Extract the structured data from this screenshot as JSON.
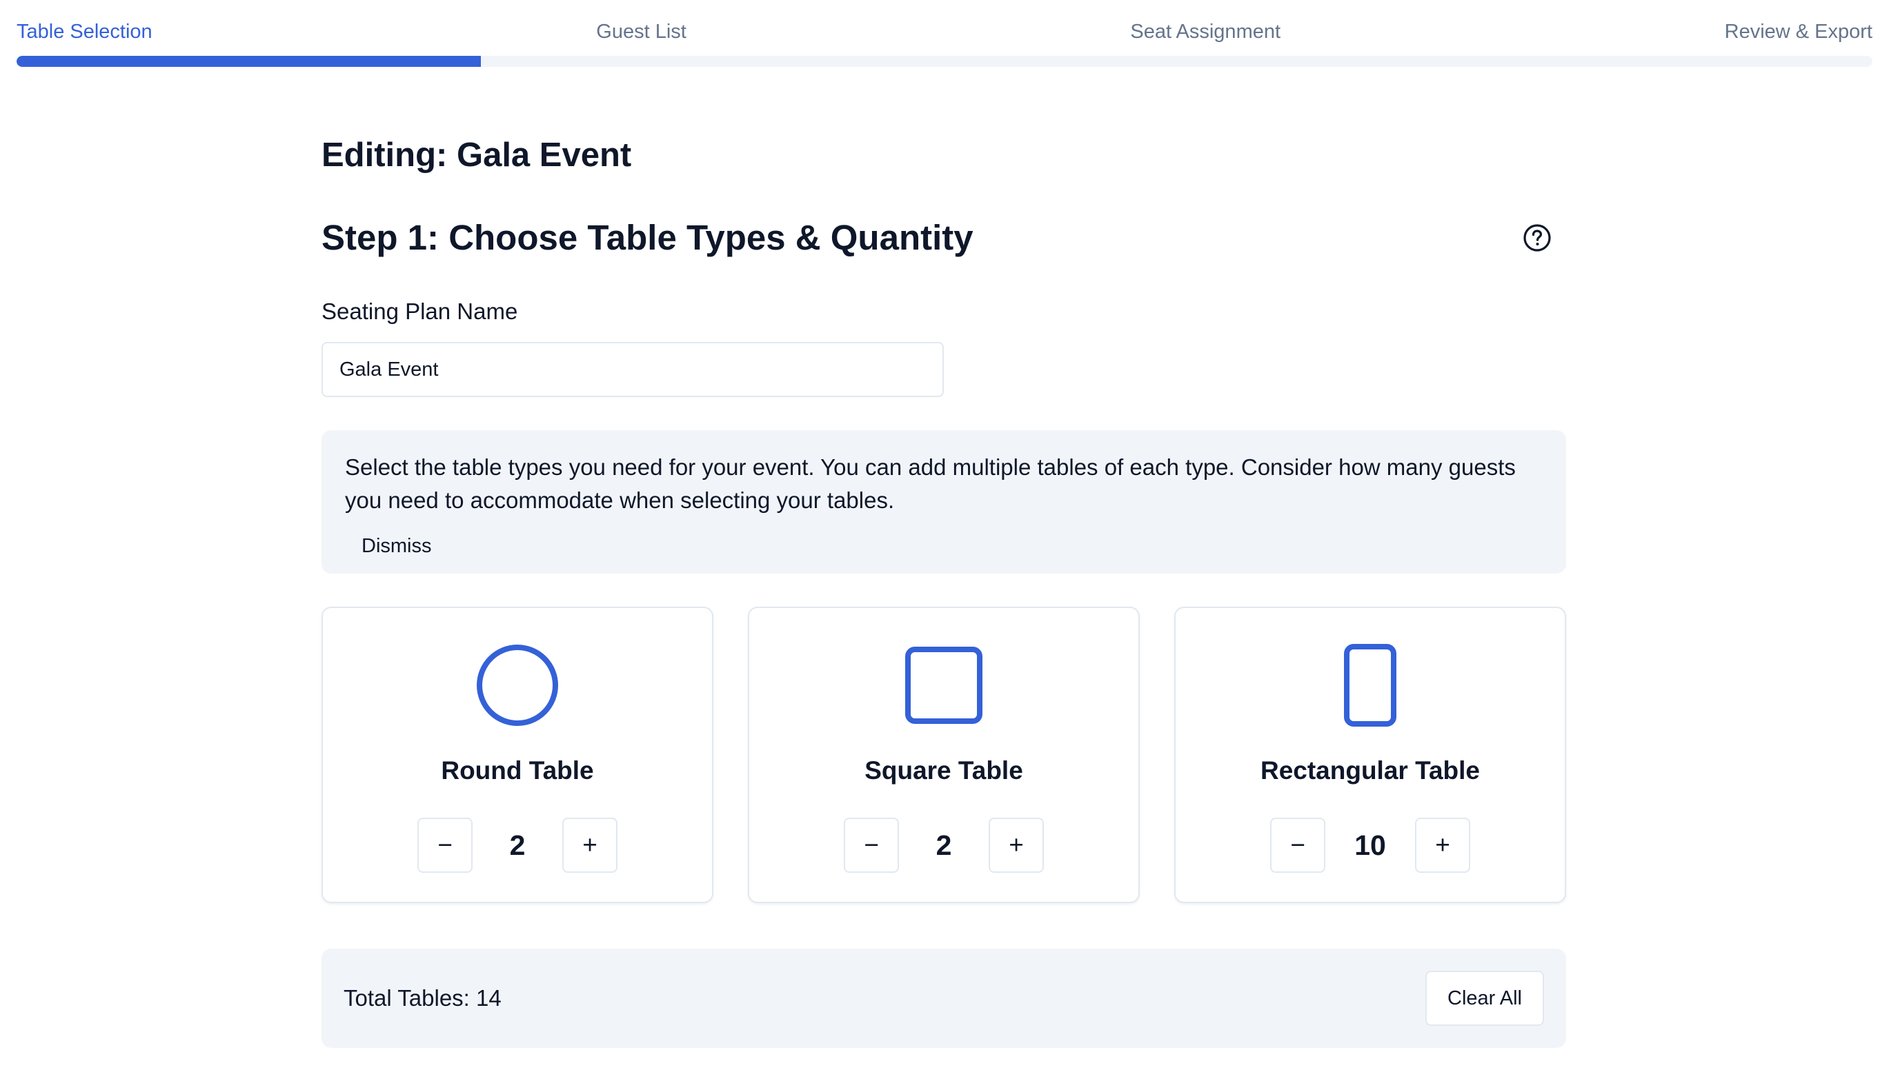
{
  "stepper": {
    "steps": [
      {
        "label": "Table Selection",
        "active": true
      },
      {
        "label": "Guest List",
        "active": false
      },
      {
        "label": "Seat Assignment",
        "active": false
      },
      {
        "label": "Review & Export",
        "active": false
      }
    ],
    "progress_fraction": 0.25,
    "accent_color": "#3461d8"
  },
  "editing_title": "Editing: Gala Event",
  "step_title": "Step 1: Choose Table Types & Quantity",
  "help_icon": "question-circle-icon",
  "seating_plan": {
    "label": "Seating Plan Name",
    "value": "Gala Event"
  },
  "info": {
    "text": "Select the table types you need for your event. You can add multiple tables of each type. Consider how many guests you need to accommodate when selecting your tables.",
    "dismiss_label": "Dismiss"
  },
  "tables": [
    {
      "name": "Round Table",
      "icon": "circle-icon",
      "quantity": "2",
      "minus": "−",
      "plus": "+"
    },
    {
      "name": "Square Table",
      "icon": "square-icon",
      "quantity": "2",
      "minus": "−",
      "plus": "+"
    },
    {
      "name": "Rectangular Table",
      "icon": "rectangle-icon",
      "quantity": "10",
      "minus": "−",
      "plus": "+"
    }
  ],
  "summary": {
    "total_label": "Total Tables: 14",
    "clear_all_label": "Clear All"
  }
}
